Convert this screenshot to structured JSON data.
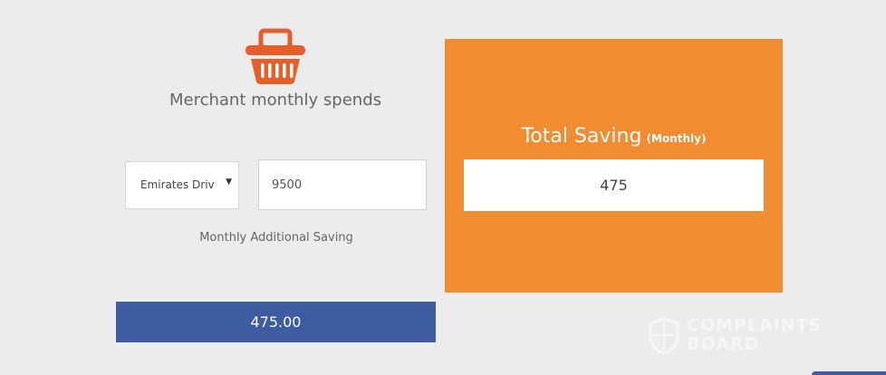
{
  "calculator": {
    "icon": "basket-icon",
    "heading": "Merchant monthly spends",
    "merchant_select": {
      "selected": "Emirates Driv"
    },
    "amount_input": {
      "value": "9500"
    },
    "sub_label": "Monthly Additional Saving",
    "result_value": "475.00"
  },
  "saving_panel": {
    "title": "Total Saving",
    "title_suffix": "(Monthly)",
    "value": "475"
  },
  "watermark": {
    "line1": "COMPLAINTS",
    "line2": "BOARD"
  },
  "colors": {
    "accent_orange": "#f28c30",
    "basket_orange": "#e85e28",
    "result_blue": "#3f5ba1",
    "background": "#ececec"
  }
}
